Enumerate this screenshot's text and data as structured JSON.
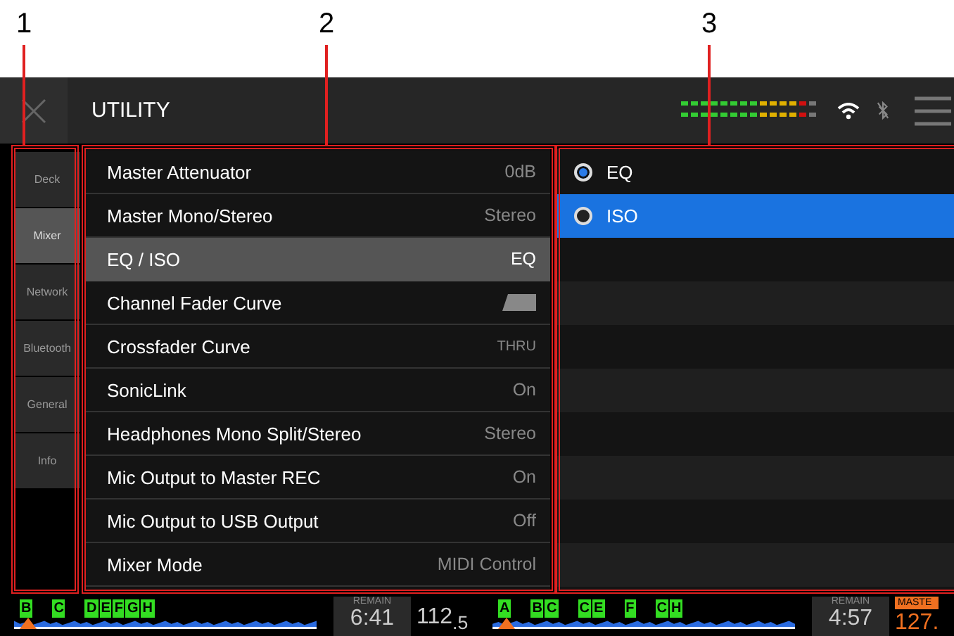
{
  "callouts": [
    "1",
    "2",
    "3"
  ],
  "header": {
    "title": "UTILITY"
  },
  "sidebar": {
    "items": [
      {
        "label": "Deck",
        "selected": false
      },
      {
        "label": "Mixer",
        "selected": true
      },
      {
        "label": "Network",
        "selected": false
      },
      {
        "label": "Bluetooth",
        "selected": false
      },
      {
        "label": "General",
        "selected": false
      },
      {
        "label": "Info",
        "selected": false
      }
    ]
  },
  "settings": [
    {
      "label": "Master Attenuator",
      "kind": "text",
      "value": "0dB",
      "selected": false
    },
    {
      "label": "Master Mono/Stereo",
      "kind": "text",
      "value": "Stereo",
      "selected": false
    },
    {
      "label": "EQ / ISO",
      "kind": "text",
      "value": "EQ",
      "selected": true
    },
    {
      "label": "Channel Fader Curve",
      "kind": "curve",
      "selected": false
    },
    {
      "label": "Crossfader Curve",
      "kind": "small",
      "value": "THRU",
      "selected": false
    },
    {
      "label": "SonicLink",
      "kind": "text",
      "value": "On",
      "selected": false
    },
    {
      "label": "Headphones Mono Split/Stereo",
      "kind": "text",
      "value": "Stereo",
      "selected": false
    },
    {
      "label": "Mic Output to Master REC",
      "kind": "text",
      "value": "On",
      "selected": false
    },
    {
      "label": "Mic Output to USB Output",
      "kind": "text",
      "value": "Off",
      "selected": false
    },
    {
      "label": "Mixer Mode",
      "kind": "text",
      "value": "MIDI Control",
      "selected": false
    }
  ],
  "options": [
    {
      "label": "EQ",
      "checked": true,
      "selected": false
    },
    {
      "label": "ISO",
      "checked": false,
      "selected": true
    }
  ],
  "decks": [
    {
      "cue_groups": [
        [
          "B"
        ],
        [
          "C"
        ],
        [
          "D",
          "E",
          "F",
          "G",
          "H"
        ]
      ],
      "remain_label": "REMAIN",
      "time": "6:41",
      "bpm": "112$_{.5}$"
    },
    {
      "cue_groups": [
        [
          "A"
        ],
        [
          "B",
          "C"
        ],
        [
          "C",
          "E"
        ],
        [
          "F"
        ],
        [
          "C",
          "H"
        ]
      ],
      "remain_label": "REMAIN",
      "time": "4:57",
      "master": "MASTE",
      "bpm": "127."
    }
  ]
}
